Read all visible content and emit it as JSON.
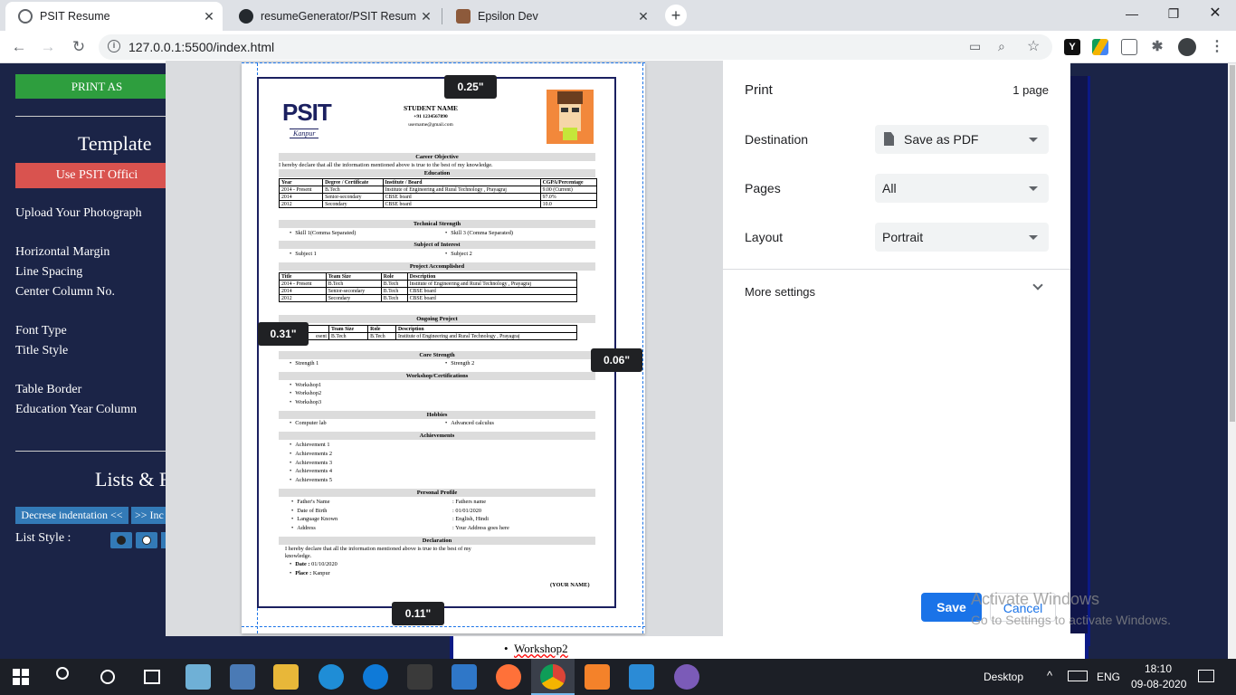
{
  "browser": {
    "tabs": [
      {
        "title": "PSIT Resume",
        "active": true
      },
      {
        "title": "resumeGenerator/PSIT Resume.p",
        "active": false
      },
      {
        "title": "Epsilon Dev",
        "active": false
      }
    ],
    "url": "127.0.0.1:5500/index.html",
    "icons": [
      "back-icon",
      "forward-icon",
      "reload-icon",
      "info-icon",
      "cast-icon",
      "zoom-icon",
      "star-icon"
    ]
  },
  "page": {
    "print_button": "PRINT AS",
    "template_heading": "Template",
    "use_psit_button": "Use PSIT Offici",
    "upload_label": "Upload Your Photograph",
    "horizontal_margin": "Horizontal Margin",
    "line_spacing": "Line Spacing",
    "center_column": "Center Column No.",
    "font_type": "Font Type",
    "title_style": "Title Style",
    "table_border": "Table Border",
    "education_year": "Education Year Column",
    "lists_heading": "Lists & F",
    "decrease_indent": "Decrese indentation <<",
    "increase_indent": ">> Inc",
    "list_style": "List Style :",
    "behind_list_item": "Workshop2"
  },
  "print": {
    "title": "Print",
    "pages_count": "1 page",
    "destination_label": "Destination",
    "destination_value": "Save as PDF",
    "pages_label": "Pages",
    "pages_value": "All",
    "layout_label": "Layout",
    "layout_value": "Portrait",
    "more_settings": "More settings",
    "save": "Save",
    "cancel": "Cancel",
    "margins": {
      "top": "0.25\"",
      "left": "0.31\"",
      "right": "0.06\"",
      "bottom": "0.11\""
    }
  },
  "resume": {
    "logo": "PSIT",
    "logo_sub": "Kanpur",
    "student_name": "STUDENT NAME",
    "phone": "+91 1234567890",
    "email": "username@gmail.com",
    "career_objective_title": "Career Objective",
    "career_objective_text": "I hereby declare that all the information mentioned above is true to the best of my knowledge.",
    "education_title": "Education",
    "education_headers": [
      "Year",
      "Degree / Certificate",
      "Institute / Board",
      "CGPA/Percentage"
    ],
    "education_rows": [
      [
        "2014 - Present",
        "B.Tech",
        "Institute of Engineering and Rural Technology , Prayagraj",
        "9.00 (Current)"
      ],
      [
        "2014",
        "Senior-secondary",
        "CBSE board",
        "97.0%"
      ],
      [
        "2012",
        "Secondary",
        "CBSE board",
        "10.0"
      ]
    ],
    "technical_title": "Technical Strength",
    "skill1": "Skill 1(Comma Separated)",
    "skill3": "Skill 3 (Comma Separated)",
    "subject_title": "Subject of Interest",
    "subject1": "Subject 1",
    "subject2": "Subject 2",
    "project_title": "Project Accomplished",
    "project_headers": [
      "Title",
      "Team Size",
      "Role",
      "Description"
    ],
    "project_rows": [
      [
        "2014 - Present",
        "B.Tech",
        "B.Tech",
        "Institute of Engineering and Rural Technology , Prayagraj"
      ],
      [
        "2014",
        "Senior-secondary",
        "B.Tech",
        "CBSE board"
      ],
      [
        "2012",
        "Secondary",
        "B.Tech",
        "CBSE board"
      ]
    ],
    "ongoing_title": "Ongoing Project",
    "ongoing_headers": [
      "",
      "Team Size",
      "Role",
      "Description"
    ],
    "ongoing_row": [
      "esent",
      "B.Tech",
      "B.Tech",
      "Institute of Engineering and Rural Technology , Prayagraj"
    ],
    "core_title": "Core Strength",
    "strength1": "Strength 1",
    "strength2": "Strength 2",
    "workshop_title": "Workshop/Certifications",
    "workshops": [
      "Workshop1",
      "Workshop2",
      "Workshop3"
    ],
    "hobbies_title": "Hobbies",
    "hobby1": "Computer lab",
    "hobby2": "Advanced calculus",
    "achievements_title": "Achievements",
    "achievements": [
      "Achievement 1",
      "Achievements 2",
      "Achievements 3",
      "Achievements 4",
      "Achievements 5"
    ],
    "personal_title": "Personal Profile",
    "personal": [
      [
        "Father's Name",
        ": Fathers name"
      ],
      [
        "Date of Birth",
        ": 01/01/2020"
      ],
      [
        "Language Known",
        ": English, Hindi"
      ],
      [
        "Address",
        ": Your Address goes here"
      ]
    ],
    "declaration_title": "Declaration",
    "declaration_text1": "I hereby declare that all the information mentioned above is true to the best of my",
    "declaration_text2": "knowledge.",
    "date_label": "Date :",
    "date_value": "01/10/2020",
    "place_label": "Place :",
    "place_value": "Kanpur",
    "signature": "(YOUR NAME)"
  },
  "watermark": {
    "line1": "Activate Windows",
    "line2": "Go to Settings to activate Windows."
  },
  "taskbar": {
    "desktop": "Desktop",
    "lang": "ENG",
    "time": "18:10",
    "date": "09-08-2020"
  },
  "colors": {
    "accent": "#1a73e8",
    "page_bg": "#1b2447",
    "green": "#2e9e3e",
    "red": "#d9534f",
    "btn_blue": "#337ab7"
  }
}
